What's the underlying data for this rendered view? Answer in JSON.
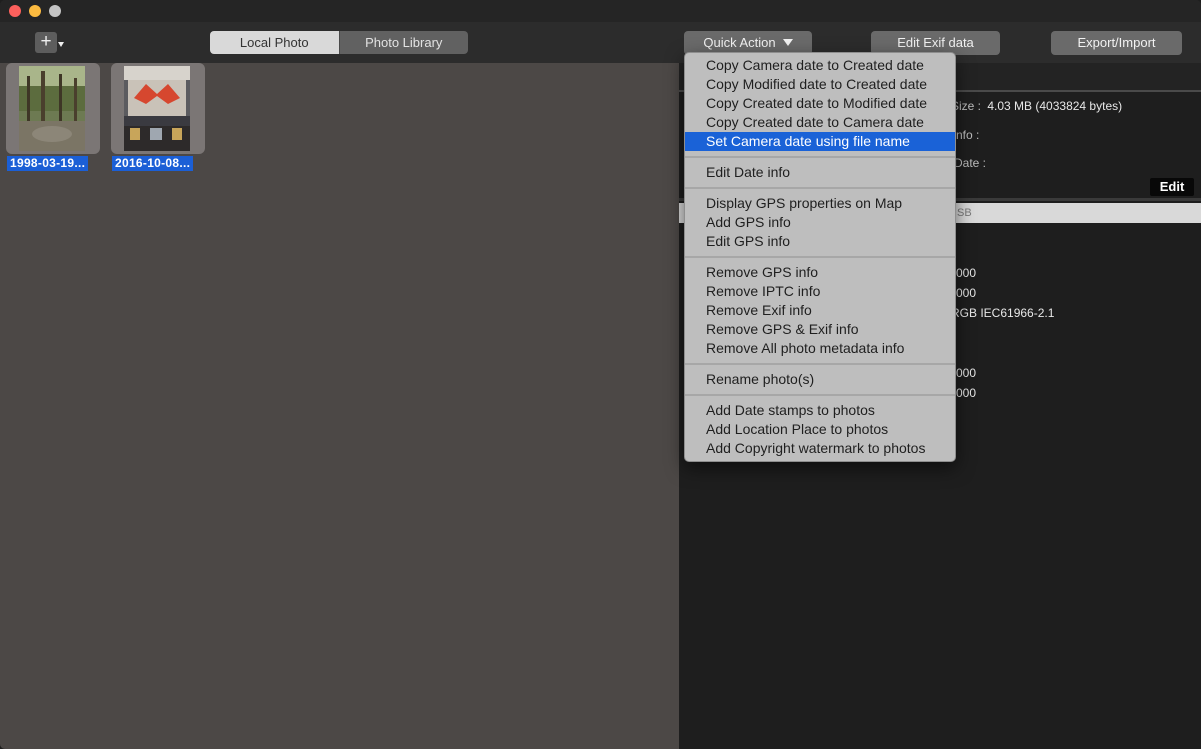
{
  "toolbar": {
    "add_symbol": "+",
    "tabs": [
      {
        "label": "Local Photo",
        "active": true
      },
      {
        "label": "Photo Library",
        "active": false
      }
    ],
    "quick_action_label": "Quick Action",
    "edit_exif_label": "Edit Exif data",
    "export_import_label": "Export/Import"
  },
  "browser": {
    "photos": [
      {
        "label": "1998-03-19..."
      },
      {
        "label": "2016-10-08..."
      }
    ]
  },
  "info": {
    "size_label": "Size :",
    "size_value": "4.03 MB (4033824 bytes)",
    "info_label": "nfo :",
    "date_label": "Date :",
    "edit_label": "Edit",
    "tabbar_fragment": "SB",
    "values": [
      "000",
      "000",
      "RGB IEC61966-2.1",
      "000",
      "000"
    ]
  },
  "menu": {
    "items": [
      {
        "label": "Copy Camera date to Created date",
        "highlighted": false
      },
      {
        "label": "Copy Modified date to Created date",
        "highlighted": false
      },
      {
        "label": "Copy Created date to Modified date",
        "highlighted": false
      },
      {
        "label": "Copy Created date to Camera date",
        "highlighted": false
      },
      {
        "label": "Set Camera date using file name",
        "highlighted": true
      },
      {
        "label": "Edit Date info",
        "highlighted": false
      },
      {
        "label": "Display GPS properties on Map",
        "highlighted": false
      },
      {
        "label": "Add GPS info",
        "highlighted": false
      },
      {
        "label": "Edit GPS  info",
        "highlighted": false
      },
      {
        "label": "Remove GPS info",
        "highlighted": false
      },
      {
        "label": "Remove IPTC info",
        "highlighted": false
      },
      {
        "label": "Remove Exif info",
        "highlighted": false
      },
      {
        "label": "Remove GPS & Exif info",
        "highlighted": false
      },
      {
        "label": "Remove All photo metadata info",
        "highlighted": false
      },
      {
        "label": "Rename photo(s)",
        "highlighted": false
      },
      {
        "label": "Add Date stamps to photos",
        "highlighted": false
      },
      {
        "label": "Add Location Place to photos",
        "highlighted": false
      },
      {
        "label": "Add Copyright watermark to photos",
        "highlighted": false
      }
    ]
  },
  "colors": {
    "highlight": "#1a62d7",
    "browser_bg": "#4c4846",
    "info_bg": "#1e1e1e",
    "menu_bg": "#bebebe"
  }
}
